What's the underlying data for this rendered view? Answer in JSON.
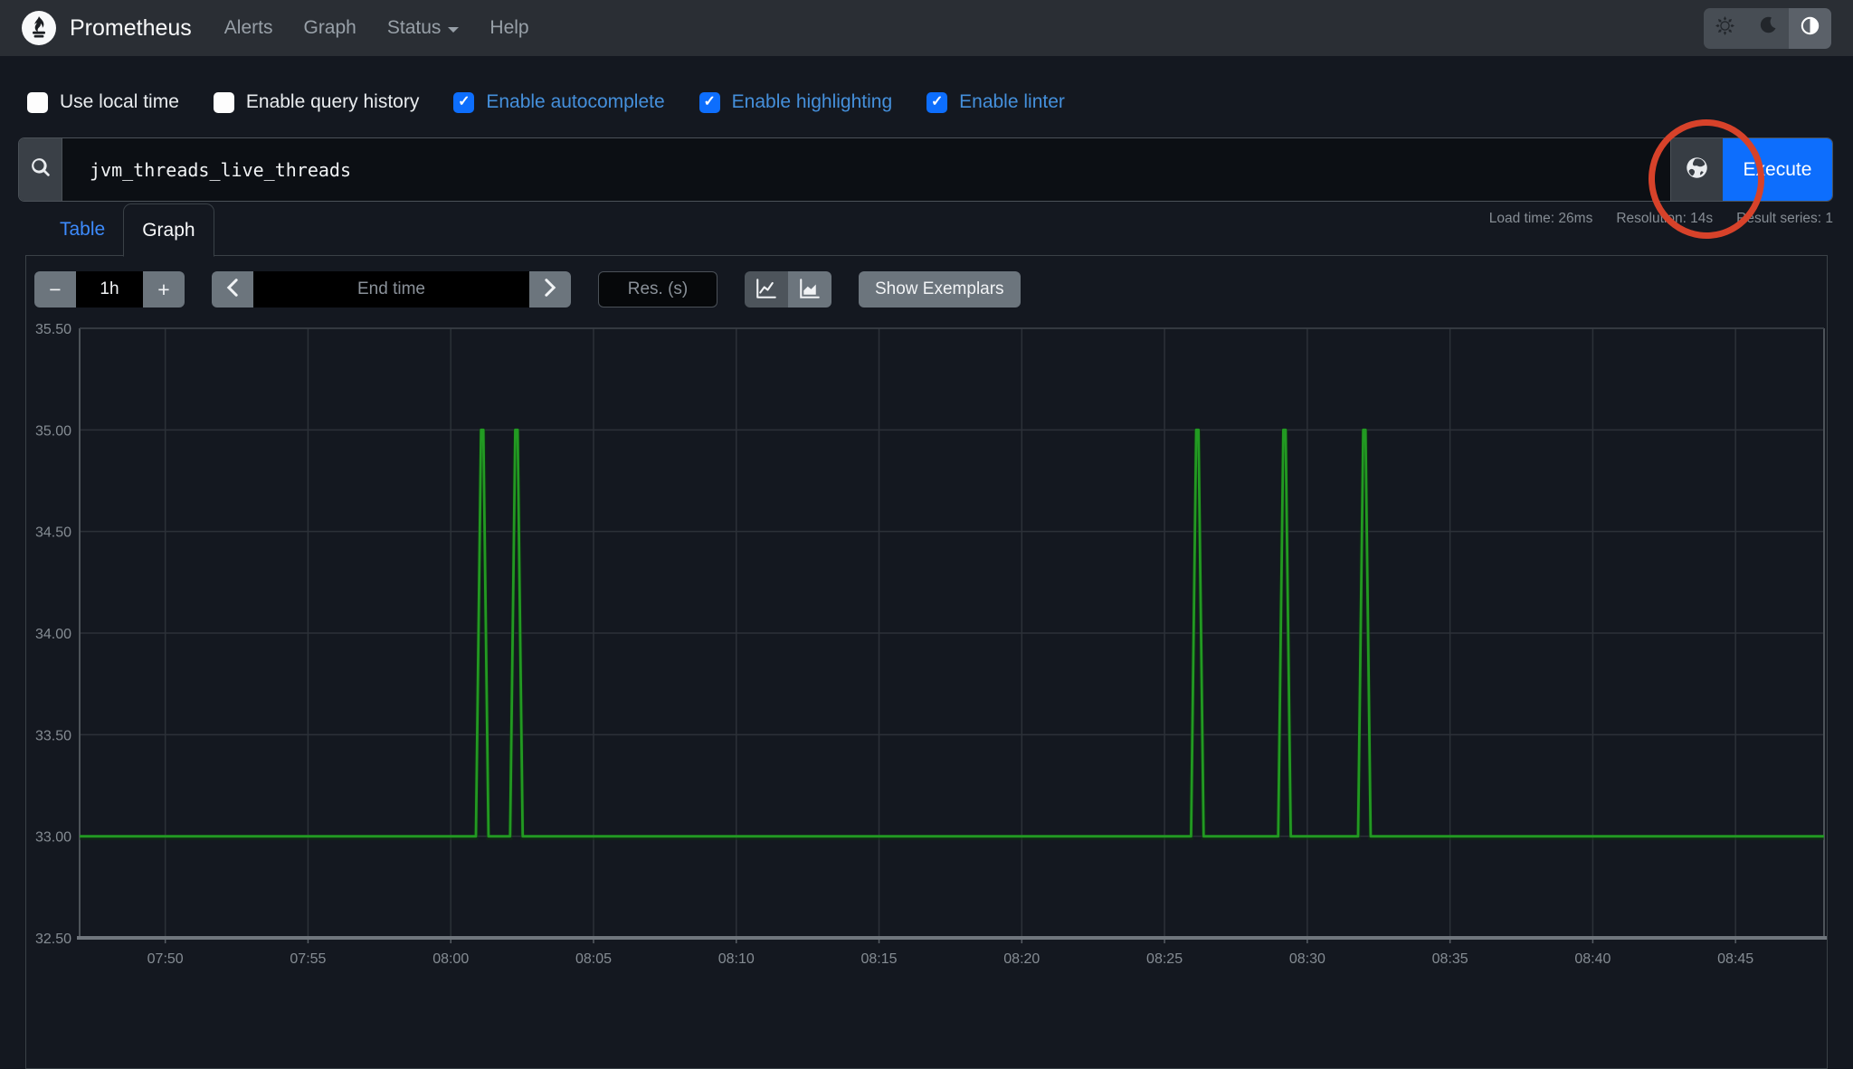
{
  "navbar": {
    "brand": "Prometheus",
    "links": [
      {
        "label": "Alerts"
      },
      {
        "label": "Graph"
      },
      {
        "label": "Status"
      },
      {
        "label": "Help"
      }
    ],
    "theme_toggle": {
      "options": [
        "light",
        "dark",
        "auto"
      ],
      "active": "auto",
      "icons": {
        "light": "sun-icon",
        "dark": "moon-icon",
        "auto": "circle-half-icon"
      }
    }
  },
  "options_row": {
    "checkboxes": [
      {
        "label": "Use local time",
        "checked": false
      },
      {
        "label": "Enable query history",
        "checked": false
      },
      {
        "label": "Enable autocomplete",
        "checked": true
      },
      {
        "label": "Enable highlighting",
        "checked": true
      },
      {
        "label": "Enable linter",
        "checked": true
      }
    ]
  },
  "query_bar": {
    "query": "jvm_threads_live_threads",
    "search_icon": "search-icon",
    "globe_icon": "globe-icon",
    "execute_label": "Execute"
  },
  "stats": {
    "load_time": "Load time: 26ms",
    "resolution": "Resolution: 14s",
    "result_series": "Result series: 1"
  },
  "tabs": [
    {
      "label": "Table",
      "active": false
    },
    {
      "label": "Graph",
      "active": true
    }
  ],
  "graph_controls": {
    "minus_label": "−",
    "range_value": "1h",
    "plus_label": "+",
    "end_time_placeholder": "End time",
    "res_placeholder": "Res. (s)",
    "chart_type_icons": [
      "line-chart-icon",
      "stacked-chart-icon"
    ],
    "chart_type_selected": "line",
    "show_exemplars_label": "Show Exemplars"
  },
  "annotation": {
    "shape": "hand-drawn-circle",
    "target": "globe-button",
    "color": "#d7422a"
  },
  "colors": {
    "accent_blue": "#0d6efd",
    "link_blue": "#3d8bfd",
    "checked_label_blue": "#4590dc",
    "series_green": "#229a22",
    "page_bg": "#141820",
    "navbar_bg": "#2a2e34",
    "annotation_red": "#d7422a"
  },
  "chart_data": {
    "type": "line",
    "legend_position": "none",
    "grid": true,
    "x_axis": {
      "domain_minutes": [
        0,
        61.1
      ],
      "domain_start_time": "07:47",
      "ticks": [
        {
          "m": 3,
          "label": "07:50"
        },
        {
          "m": 8,
          "label": "07:55"
        },
        {
          "m": 13,
          "label": "08:00"
        },
        {
          "m": 18,
          "label": "08:05"
        },
        {
          "m": 23,
          "label": "08:10"
        },
        {
          "m": 28,
          "label": "08:15"
        },
        {
          "m": 33,
          "label": "08:20"
        },
        {
          "m": 38,
          "label": "08:25"
        },
        {
          "m": 43,
          "label": "08:30"
        },
        {
          "m": 48,
          "label": "08:35"
        },
        {
          "m": 53,
          "label": "08:40"
        },
        {
          "m": 58,
          "label": "08:45"
        }
      ]
    },
    "y_axis": {
      "lim": [
        32.5,
        35.5
      ],
      "ticks": [
        {
          "v": 35.5,
          "label": "35.50"
        },
        {
          "v": 35.0,
          "label": "35.00"
        },
        {
          "v": 34.5,
          "label": "34.50"
        },
        {
          "v": 34.0,
          "label": "34.00"
        },
        {
          "v": 33.5,
          "label": "33.50"
        },
        {
          "v": 33.0,
          "label": "33.00"
        },
        {
          "v": 32.5,
          "label": "32.50"
        }
      ]
    },
    "series": [
      {
        "name": "jvm_threads_live_threads",
        "color": "#229a22",
        "baseline": 33,
        "peak": 35,
        "spike_times": [
          "08:01",
          "08:02",
          "08:26",
          "08:29",
          "08:32"
        ],
        "points": [
          [
            0,
            33
          ],
          [
            13.88,
            33
          ],
          [
            14.06,
            35
          ],
          [
            14.14,
            35
          ],
          [
            14.32,
            33
          ],
          [
            15.08,
            33
          ],
          [
            15.26,
            35
          ],
          [
            15.34,
            35
          ],
          [
            15.52,
            33
          ],
          [
            38.93,
            33
          ],
          [
            39.11,
            35
          ],
          [
            39.19,
            35
          ],
          [
            39.37,
            33
          ],
          [
            41.98,
            33
          ],
          [
            42.16,
            35
          ],
          [
            42.24,
            35
          ],
          [
            42.42,
            33
          ],
          [
            44.78,
            33
          ],
          [
            44.96,
            35
          ],
          [
            45.04,
            35
          ],
          [
            45.22,
            33
          ],
          [
            61.1,
            33
          ]
        ]
      }
    ]
  }
}
